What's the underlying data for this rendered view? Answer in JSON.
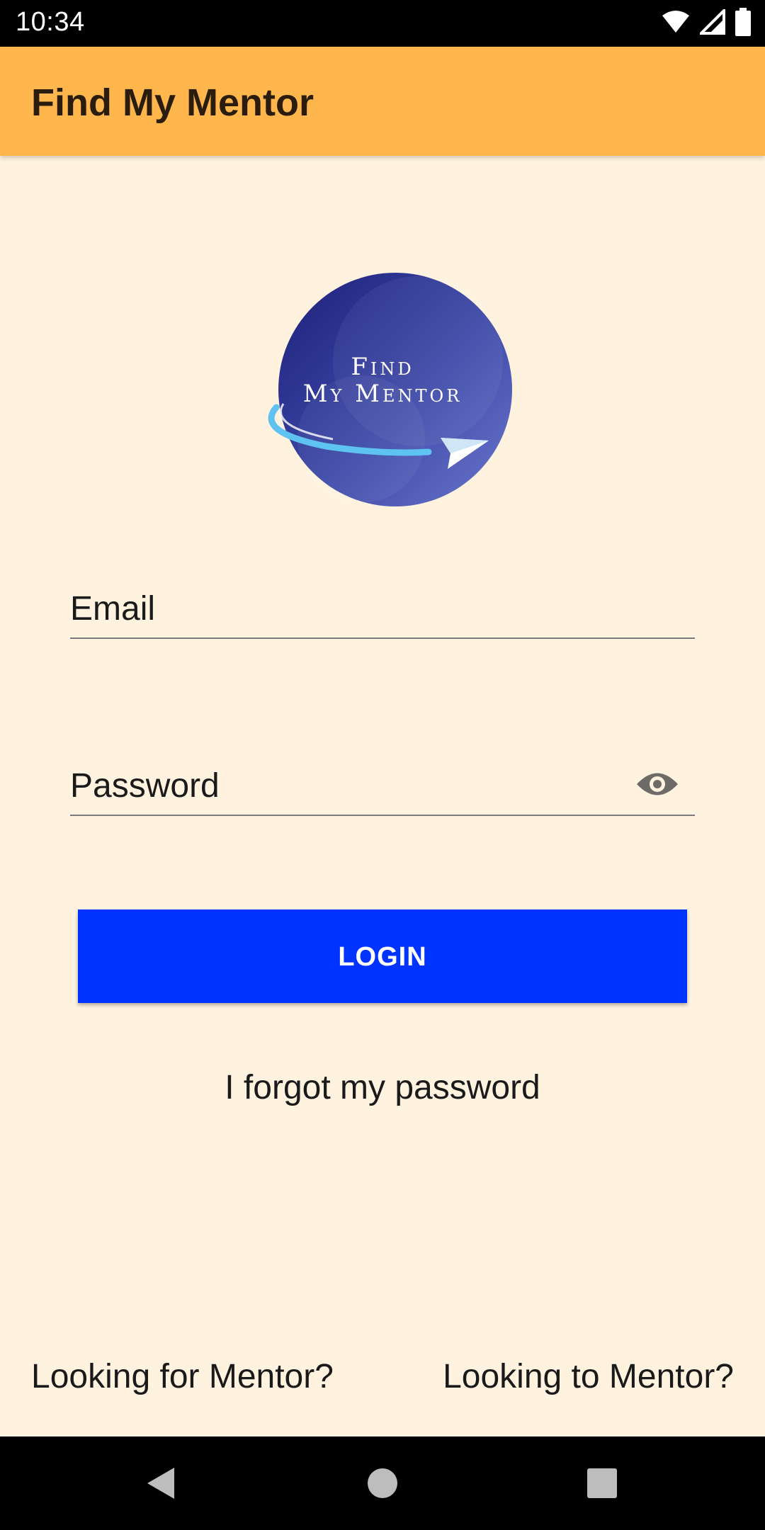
{
  "status_bar": {
    "time": "10:34",
    "icons": [
      "wifi-icon",
      "cell-signal-icon",
      "battery-icon"
    ]
  },
  "app_bar": {
    "title": "Find My Mentor",
    "color": "#FFB74D"
  },
  "logo": {
    "line1": "Find",
    "line2": "My Mentor"
  },
  "form": {
    "email_label": "Email",
    "password_label": "Password",
    "password_toggle_icon": "eye-icon",
    "login_label": "LOGIN",
    "login_color": "#0033FF",
    "forgot_label": "I forgot my password"
  },
  "footer": {
    "mentee_link": "Looking for Mentor?",
    "mentor_link": "Looking to Mentor?"
  },
  "nav_bar": {
    "icons": [
      "back-icon",
      "home-icon",
      "recents-icon"
    ]
  },
  "colors": {
    "background": "#FFF3E0",
    "accent": "#0033FF"
  }
}
